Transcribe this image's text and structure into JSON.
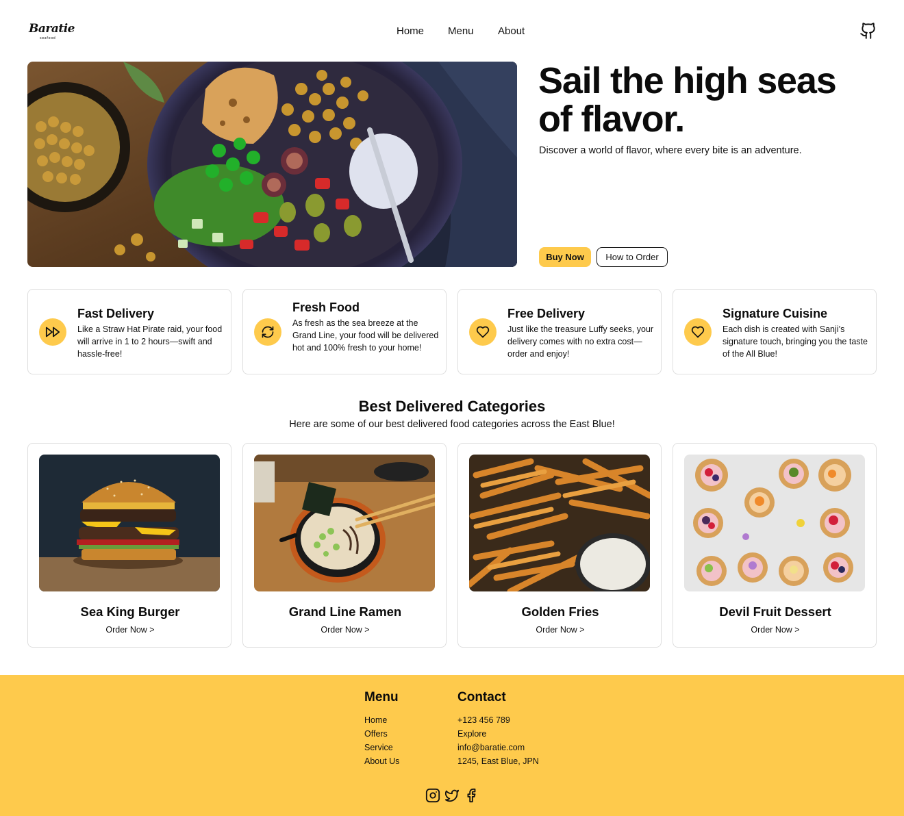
{
  "brand": {
    "name": "Baratie",
    "tagline": "seafood"
  },
  "nav": {
    "items": [
      "Home",
      "Menu",
      "About"
    ]
  },
  "hero": {
    "title": "Sail the high seas of flavor.",
    "subtitle": "Discover a world of flavor, where every bite is an adventure.",
    "buy_label": "Buy Now",
    "how_label": "How to Order"
  },
  "features": [
    {
      "title": "Fast Delivery",
      "icon": "fast-forward-icon",
      "desc": "Like a Straw Hat Pirate raid, your food will arrive in 1 to 2 hours—swift and hassle-free!"
    },
    {
      "title": "Fresh Food",
      "icon": "refresh-icon",
      "desc": "As fresh as the sea breeze at the Grand Line, your food will be delivered hot and 100% fresh to your home!"
    },
    {
      "title": "Free Delivery",
      "icon": "heart-icon",
      "desc": "Just like the treasure Luffy seeks, your delivery comes with no extra cost—order and enjoy!"
    },
    {
      "title": "Signature Cuisine",
      "icon": "heart-icon",
      "desc": "Each dish is created with Sanji’s signature touch, bringing you the taste of the All Blue!"
    }
  ],
  "categories_section": {
    "title": "Best Delivered Categories",
    "subtitle": "Here are some of our best delivered food categories across the East Blue!"
  },
  "categories": [
    {
      "name": "Sea King Burger",
      "order": "Order Now >"
    },
    {
      "name": "Grand Line Ramen",
      "order": "Order Now >"
    },
    {
      "name": "Golden Fries",
      "order": "Order Now >"
    },
    {
      "name": "Devil Fruit Dessert",
      "order": "Order Now >"
    }
  ],
  "footer": {
    "menu": {
      "title": "Menu",
      "items": [
        "Home",
        "Offers",
        "Service",
        "About Us"
      ]
    },
    "contact": {
      "title": "Contact",
      "items": [
        "+123 456 789",
        "Explore",
        "info@baratie.com",
        "1245, East Blue, JPN"
      ]
    },
    "social": [
      "instagram-icon",
      "twitter-icon",
      "facebook-icon"
    ]
  },
  "colors": {
    "accent": "#FECA4C",
    "text": "#111111",
    "border": "#dedede"
  }
}
